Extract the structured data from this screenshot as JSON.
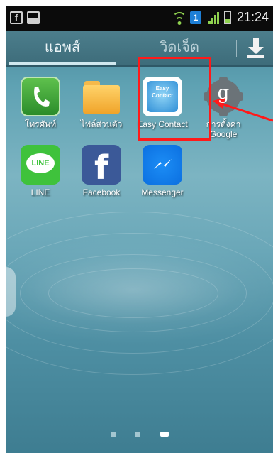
{
  "status_bar": {
    "time": "21:24",
    "notification_count": "1",
    "left_icons": [
      "facebook-notification-icon",
      "image-notification-icon"
    ]
  },
  "tabs": [
    {
      "label": "แอพส์",
      "active": true
    },
    {
      "label": "วิดเจ็ต",
      "active": false
    }
  ],
  "apps_row1": [
    {
      "label": "โทรศัพท์",
      "icon": "phone-icon"
    },
    {
      "label": "ไฟล์ส่วนตัว",
      "icon": "folder-icon"
    },
    {
      "label": "Easy Contact",
      "icon": "easy-contact-icon",
      "icon_text": "Easy Contact"
    },
    {
      "label": "การตั้งค่า Google",
      "icon": "google-settings-icon",
      "icon_text": "g"
    }
  ],
  "apps_row2": [
    {
      "label": "LINE",
      "icon": "line-icon",
      "icon_text": "LINE"
    },
    {
      "label": "Facebook",
      "icon": "facebook-icon",
      "icon_text": "f"
    },
    {
      "label": "Messenger",
      "icon": "messenger-icon"
    }
  ],
  "page_indicator": {
    "pages": 3,
    "active": 3
  },
  "colors": {
    "highlight": "#ff1a1a",
    "tab_bar": "#3d6c7a",
    "accent_green": "#8fd14f"
  }
}
